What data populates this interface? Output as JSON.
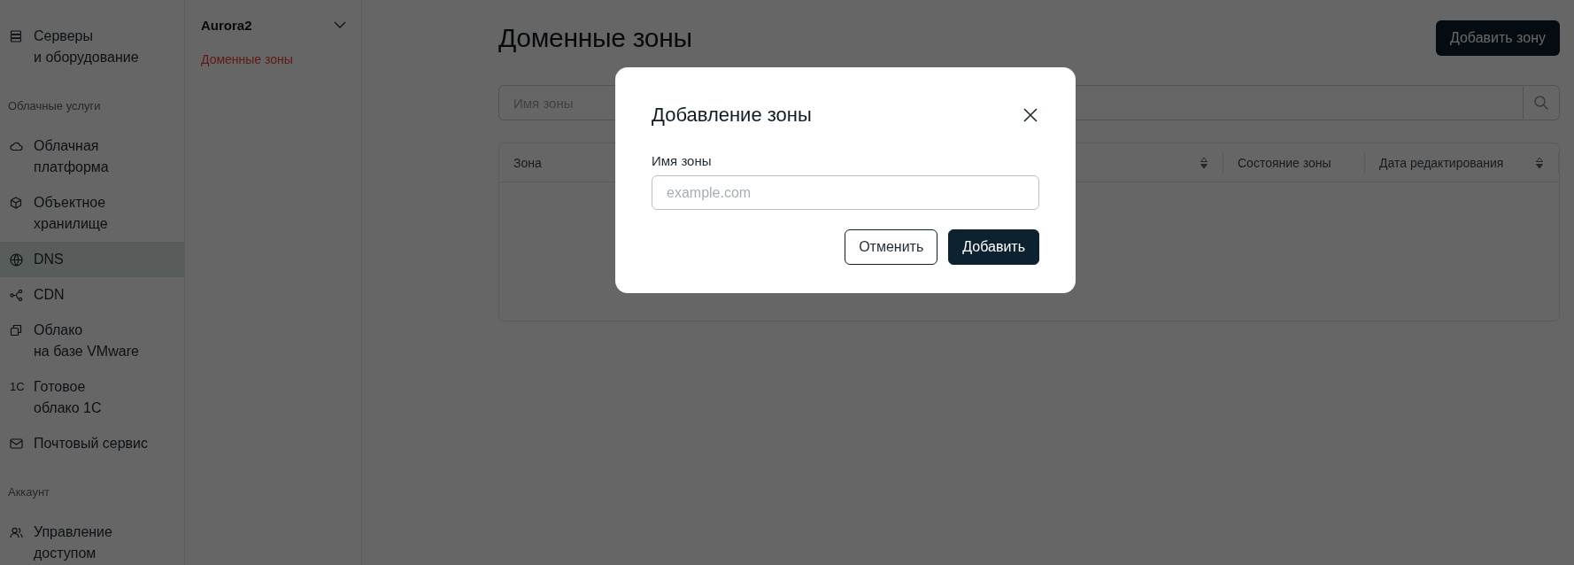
{
  "sidebar": {
    "groups": [
      {
        "items": [
          {
            "label": "Серверы\nи оборудование",
            "selected": false
          }
        ]
      },
      {
        "heading": "Облачные услуги",
        "items": [
          {
            "label": "Облачная\nплатформа",
            "selected": false
          },
          {
            "label": "Объектное\nхранилище",
            "selected": false
          },
          {
            "label": "DNS",
            "selected": true
          },
          {
            "label": "CDN",
            "selected": false
          },
          {
            "label": "Облако\nна базе VMware",
            "selected": false
          },
          {
            "label": "Готовое\nоблако 1С",
            "icon_text": "1C",
            "selected": false
          },
          {
            "label": "Почтовый сервис",
            "selected": false
          }
        ]
      },
      {
        "heading": "Аккаунт",
        "items": [
          {
            "label": "Управление\nдоступом",
            "selected": false
          }
        ]
      }
    ]
  },
  "project": {
    "name": "Aurora2",
    "expanded": false,
    "items": [
      {
        "label": "Доменные зоны",
        "selected": true
      }
    ]
  },
  "main": {
    "title": "Доменные зоны",
    "add_button": "Добавить зону",
    "search": {
      "placeholder": "Имя зоны"
    },
    "table": {
      "columns": [
        {
          "label": "Зона",
          "sortable": false
        },
        {
          "sortable": true
        },
        {
          "label": "Состояние зоны",
          "sortable": false
        },
        {
          "label": "Дата редактирования",
          "sortable": true
        }
      ]
    }
  },
  "modal": {
    "title": "Добавление зоны",
    "field_label": "Имя зоны",
    "placeholder": "example.com",
    "buttons": [
      {
        "label": "Отменить",
        "kind": "secondary"
      },
      {
        "label": "Добавить",
        "kind": "primary"
      }
    ]
  }
}
